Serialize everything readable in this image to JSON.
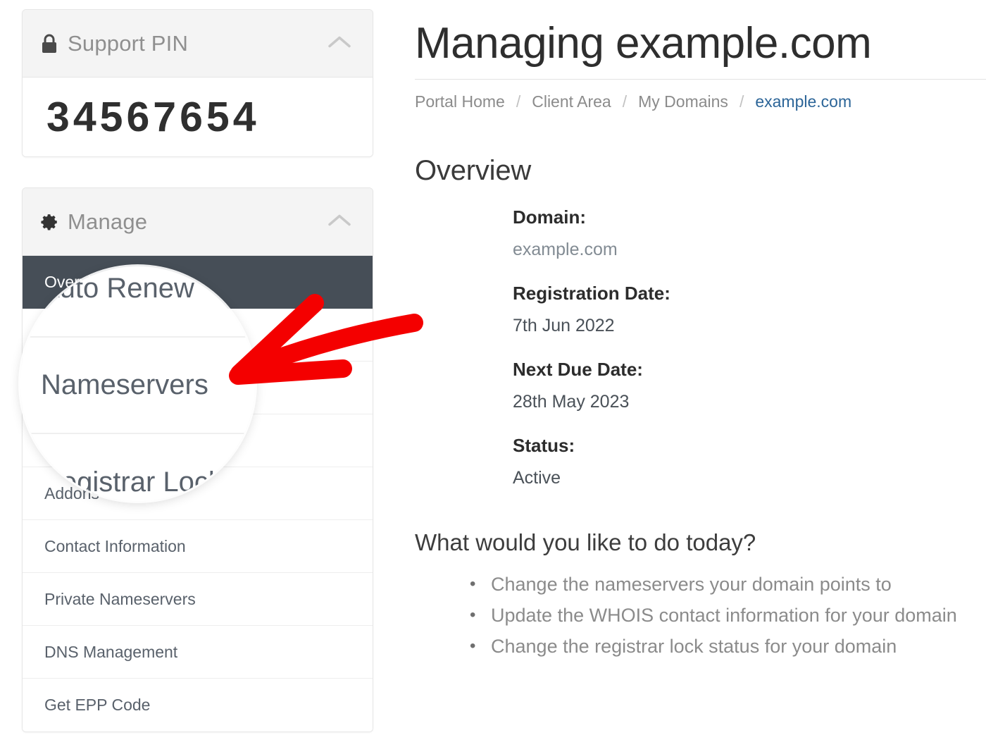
{
  "sidebar": {
    "support_pin_panel": {
      "title": "Support PIN",
      "icon": "lock-icon",
      "collapse_icon": "chevron-up-icon",
      "pin": "34567654"
    },
    "manage_panel": {
      "title": "Manage",
      "icon": "gear-icon",
      "collapse_icon": "chevron-up-icon",
      "items": [
        {
          "label": "Overview",
          "active": true
        },
        {
          "label": "Auto Renew",
          "active": false
        },
        {
          "label": "Nameservers",
          "active": false
        },
        {
          "label": "Registrar Lock",
          "active": false
        },
        {
          "label": "Addons",
          "active": false
        },
        {
          "label": "Contact Information",
          "active": false
        },
        {
          "label": "Private Nameservers",
          "active": false
        },
        {
          "label": "DNS Management",
          "active": false
        },
        {
          "label": "Get EPP Code",
          "active": false
        }
      ]
    }
  },
  "header": {
    "title": "Managing example.com",
    "breadcrumb": [
      {
        "label": "Portal Home",
        "current": false
      },
      {
        "label": "Client Area",
        "current": false
      },
      {
        "label": "My Domains",
        "current": false
      },
      {
        "label": "example.com",
        "current": true
      }
    ],
    "separator": "/"
  },
  "overview": {
    "heading": "Overview",
    "fields": [
      {
        "label": "Domain:",
        "value": "example.com"
      },
      {
        "label": "Registration Date:",
        "value": "7th Jun 2022"
      },
      {
        "label": "Next Due Date:",
        "value": "28th May 2023"
      },
      {
        "label": "Status:",
        "value": "Active"
      }
    ]
  },
  "todo": {
    "heading": "What would you like to do today?",
    "items": [
      "Change the nameservers your domain points to",
      "Update the WHOIS contact information for your domain",
      "Change the registrar lock status for your domain"
    ]
  },
  "annotation": {
    "magnifier": {
      "target_label": "Nameservers",
      "visible_rows": [
        "Auto Renew",
        "Nameservers",
        "Registrar Lock"
      ]
    },
    "arrow_color": "#f40000"
  },
  "colors": {
    "active_nav_bg": "#464e57",
    "panel_header_bg": "#f4f4f4",
    "link": "#2c6598",
    "body_text": "#59616b",
    "muted_text": "#8b8b8b",
    "annotation_red": "#f40000"
  }
}
